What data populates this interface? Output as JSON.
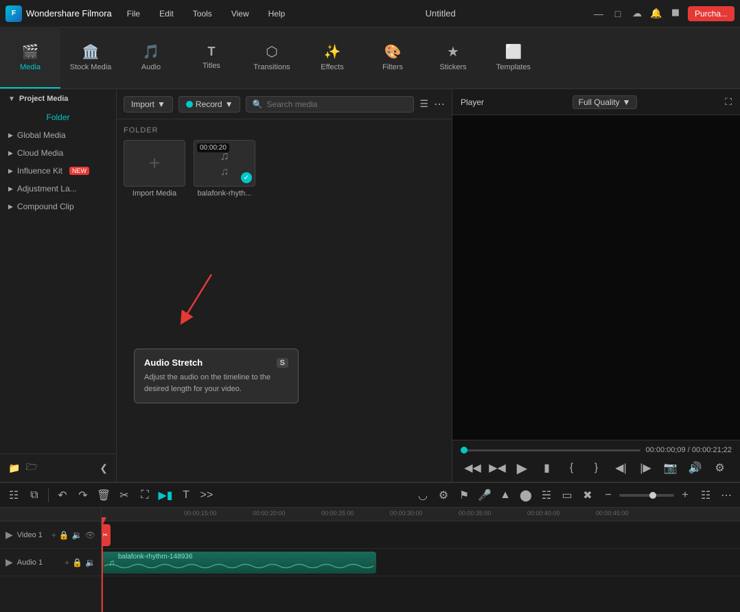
{
  "app": {
    "name": "Wondershare Filmora",
    "title": "Untitled",
    "logo_icon": "F"
  },
  "menu": {
    "items": [
      "File",
      "Edit",
      "Tools",
      "View",
      "Help"
    ]
  },
  "topbar_icons": [
    "minimize",
    "maximize",
    "cloud-upload",
    "notification",
    "grid"
  ],
  "purchase_label": "Purcha...",
  "navtabs": [
    {
      "id": "media",
      "label": "Media",
      "icon": "🎬",
      "active": true
    },
    {
      "id": "stock-media",
      "label": "Stock Media",
      "icon": "🏛️",
      "active": false
    },
    {
      "id": "audio",
      "label": "Audio",
      "icon": "🎵",
      "active": false
    },
    {
      "id": "titles",
      "label": "Titles",
      "icon": "T",
      "active": false
    },
    {
      "id": "transitions",
      "label": "Transitions",
      "icon": "⬡",
      "active": false
    },
    {
      "id": "effects",
      "label": "Effects",
      "icon": "✨",
      "active": false
    },
    {
      "id": "filters",
      "label": "Filters",
      "icon": "🎨",
      "active": false
    },
    {
      "id": "stickers",
      "label": "Stickers",
      "icon": "★",
      "active": false
    },
    {
      "id": "templates",
      "label": "Templates",
      "icon": "⬜",
      "active": false
    }
  ],
  "sidebar": {
    "header": "Project Media",
    "folder_label": "Folder",
    "sections": [
      {
        "id": "global-media",
        "label": "Global Media"
      },
      {
        "id": "cloud-media",
        "label": "Cloud Media"
      },
      {
        "id": "influence-kit",
        "label": "Influence Kit",
        "badge": "NEW"
      },
      {
        "id": "adjustment-la",
        "label": "Adjustment La..."
      },
      {
        "id": "compound-clip",
        "label": "Compound Clip"
      }
    ]
  },
  "toolbar": {
    "import_label": "Import",
    "record_label": "Record",
    "search_placeholder": "Search media"
  },
  "media_folder": {
    "label": "FOLDER",
    "items": [
      {
        "id": "import-media",
        "label": "Import Media",
        "type": "import"
      },
      {
        "id": "balafonk",
        "label": "balafonk-rhyth...",
        "type": "audio",
        "duration": "00:00:20"
      }
    ]
  },
  "player": {
    "label": "Player",
    "quality": "Full Quality",
    "current_time": "00:00:00;09",
    "total_time": "00:00:21;22"
  },
  "player_controls": {
    "buttons": [
      "step-back",
      "play-back",
      "play",
      "stop",
      "mark-in",
      "mark-out",
      "prev-frame",
      "next-frame",
      "screenshot",
      "audio",
      "settings"
    ]
  },
  "timeline_toolbar": {
    "buttons": [
      "grid",
      "select",
      "separator",
      "undo",
      "redo",
      "delete",
      "cut",
      "transform",
      "audio-stretch",
      "text",
      "more"
    ],
    "right_buttons": [
      "snap",
      "gear",
      "mark",
      "mic",
      "speed",
      "color",
      "scene",
      "picture-in-picture",
      "remove-bg",
      "minus",
      "zoom",
      "plus",
      "grid-view",
      "more"
    ]
  },
  "audio_stretch_tooltip": {
    "title": "Audio Stretch",
    "badge": "S",
    "description": "Adjust the audio on the timeline to the desired length for your video."
  },
  "tracks": [
    {
      "id": "video-1",
      "label": "Video 1",
      "icons": [
        "add",
        "lock",
        "volume",
        "eye"
      ]
    },
    {
      "id": "audio-1",
      "label": "Audio 1",
      "icons": [
        "add",
        "lock",
        "volume"
      ]
    }
  ],
  "ruler_times": [
    "00:00:15:00",
    "00:00:20:00",
    "00:00:25:00",
    "00:00:30:00",
    "00:00:35:00",
    "00:00:40:00",
    "00:00:45:00"
  ],
  "audio_clip": {
    "label": "balafonk-rhythm-148936",
    "color": "#1a6b5a"
  },
  "colors": {
    "accent": "#00c8c8",
    "danger": "#e53935",
    "bg_dark": "#1a1a1a",
    "bg_mid": "#1e1e1e",
    "bg_light": "#252525"
  }
}
